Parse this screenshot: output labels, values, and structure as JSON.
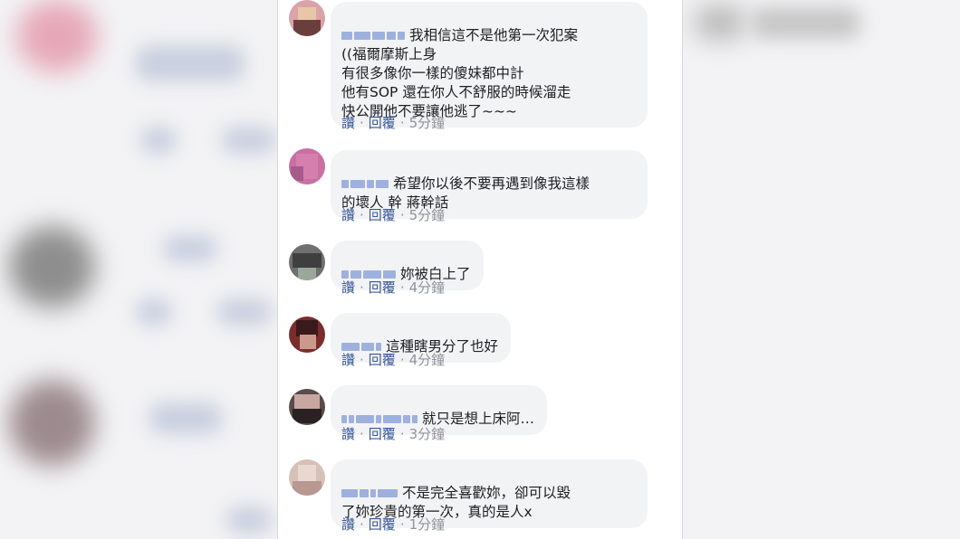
{
  "comments": [
    {
      "lines": [
        "我相信這不是他第一次犯案",
        "((福爾摩斯上身",
        "有很多像你一樣的傻妹都中計",
        "他有SOP 還在你人不舒服的時候溜走",
        "快公開他不要讓他逃了~~~"
      ],
      "like": "讚",
      "reply": "回覆",
      "time": "5分鐘"
    },
    {
      "lines": [
        "希望你以後不要再遇到像我這樣",
        "的壞人 幹 蔣幹話"
      ],
      "like": "讚",
      "reply": "回覆",
      "time": "5分鐘"
    },
    {
      "lines": [
        "妳被白上了"
      ],
      "like": "讚",
      "reply": "回覆",
      "time": "4分鐘"
    },
    {
      "lines": [
        "這種瞎男分了也好"
      ],
      "like": "讚",
      "reply": "回覆",
      "time": "4分鐘"
    },
    {
      "lines": [
        "就只是想上床阿…"
      ],
      "like": "讚",
      "reply": "回覆",
      "time": "3分鐘"
    },
    {
      "lines": [
        "不是完全喜歡妳，卻可以毀",
        "了妳珍貴的第一次，真的是人x"
      ],
      "like": "讚",
      "reply": "回覆",
      "time": "1分鐘"
    }
  ],
  "separator": "·",
  "colors": {
    "link": "#385898",
    "bubble": "#f2f3f5",
    "meta": "#90949c",
    "text": "#1c1e21"
  }
}
